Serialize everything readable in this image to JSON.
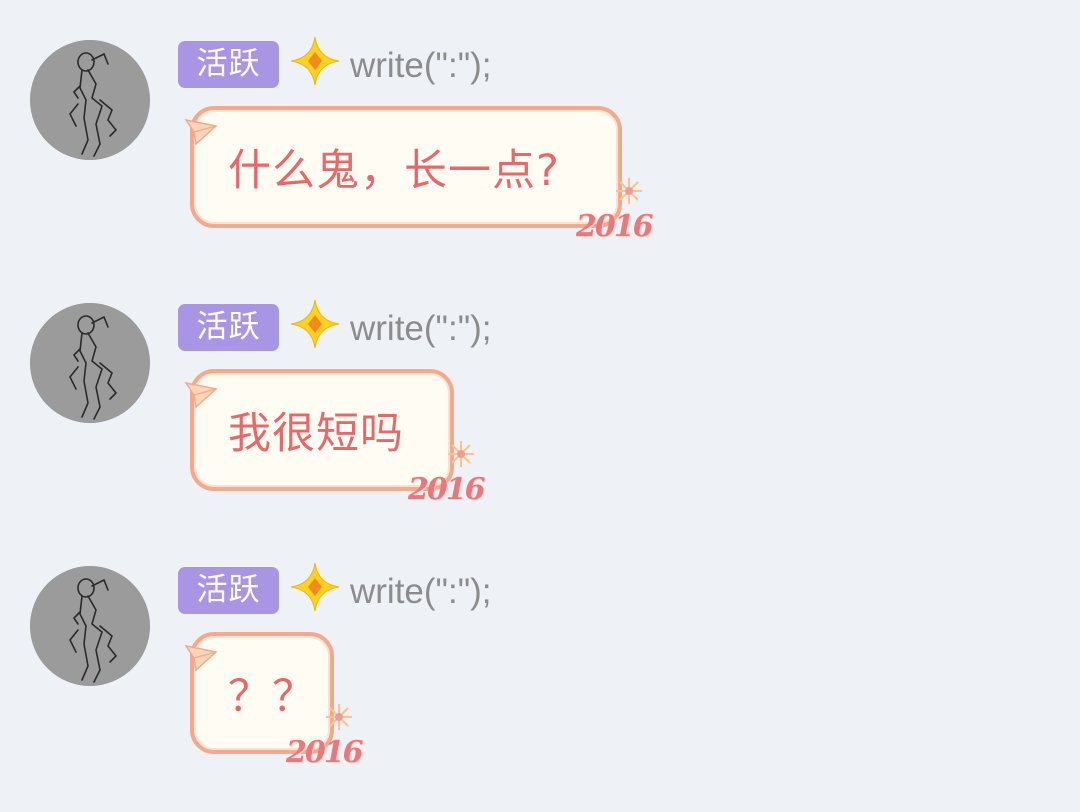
{
  "messages": [
    {
      "badge": "活跃",
      "nickname": "write(\":\");",
      "text": "什么鬼，长一点?",
      "stamp": "2016"
    },
    {
      "badge": "活跃",
      "nickname": "write(\":\");",
      "text": "我很短吗",
      "stamp": "2016"
    },
    {
      "badge": "活跃",
      "nickname": "write(\":\");",
      "text": "？？",
      "stamp": "2016"
    }
  ],
  "icons": {
    "avatar": "avatar-sketch-figure",
    "level": "star-icon",
    "bubble_decoration": "paper-plane-icon"
  },
  "colors": {
    "background": "#eef2f6",
    "badge": "#a896e4",
    "bubble_border": "#f3a98e",
    "bubble_fill": "#fffdf3",
    "bubble_text": "#e8686a",
    "nickname": "#8c8c8c",
    "star": "#ffd21f"
  }
}
